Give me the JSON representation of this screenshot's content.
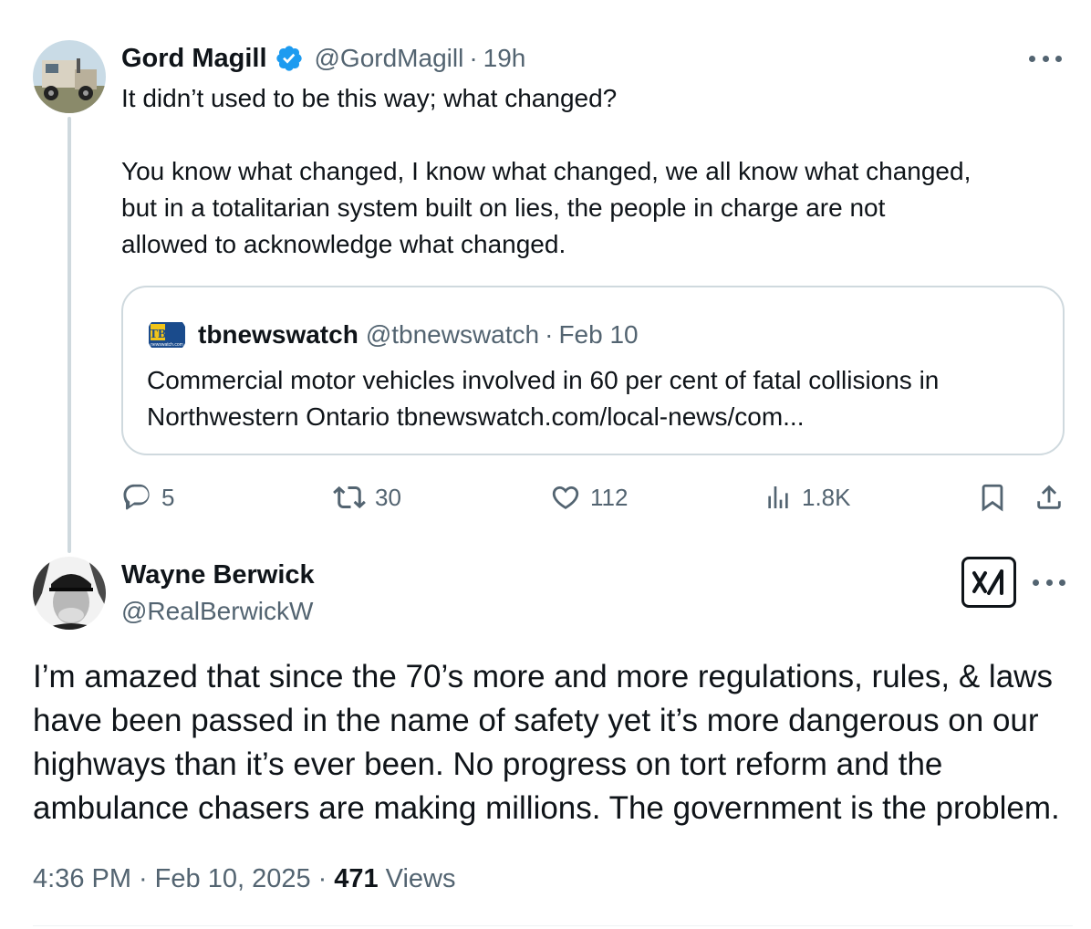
{
  "tweet1": {
    "author_name": "Gord Magill",
    "handle": "@GordMagill",
    "separator": "·",
    "time": "19h",
    "avatar_icon": "truck-photo-avatar",
    "body_lines": [
      "It didn’t used to be this way; what changed?",
      "You know what changed, I know what changed, we all know what changed,",
      "but in a totalitarian system built on lies, the people in charge are not",
      "allowed to acknowledge what changed."
    ],
    "quote": {
      "logo_text": "TB",
      "logo_subtext": "newswatch.com",
      "author_name": "tbnewswatch",
      "handle": "@tbnewswatch",
      "separator": "·",
      "date": "Feb 10",
      "body_lines": [
        "Commercial motor vehicles involved in 60 per cent of fatal collisions in",
        "Northwestern Ontario tbnewswatch.com/local-news/com..."
      ]
    },
    "actions": {
      "replies": "5",
      "reposts": "30",
      "likes": "112",
      "views": "1.8K"
    }
  },
  "tweet2": {
    "author_name": "Wayne Berwick",
    "handle": "@RealBerwickW",
    "avatar_icon": "man-with-cap-avatar",
    "grok_icon": "grok-icon",
    "body_lines": [
      "I’m amazed that since the 70’s more and more regulations, rules, & laws",
      "have been passed in the name of safety yet it’s more dangerous on our",
      "highways than it’s ever been. No progress on tort reform and the",
      "ambulance chasers are making millions. The government is the problem."
    ],
    "meta": {
      "time": "4:36 PM",
      "date": "Feb 10, 2025",
      "separator": "·",
      "views_count": "471",
      "views_label": "Views"
    }
  },
  "colors": {
    "text": "#0f1419",
    "muted": "#536471",
    "verified": "#1d9bf0",
    "border": "#cfd9de"
  }
}
